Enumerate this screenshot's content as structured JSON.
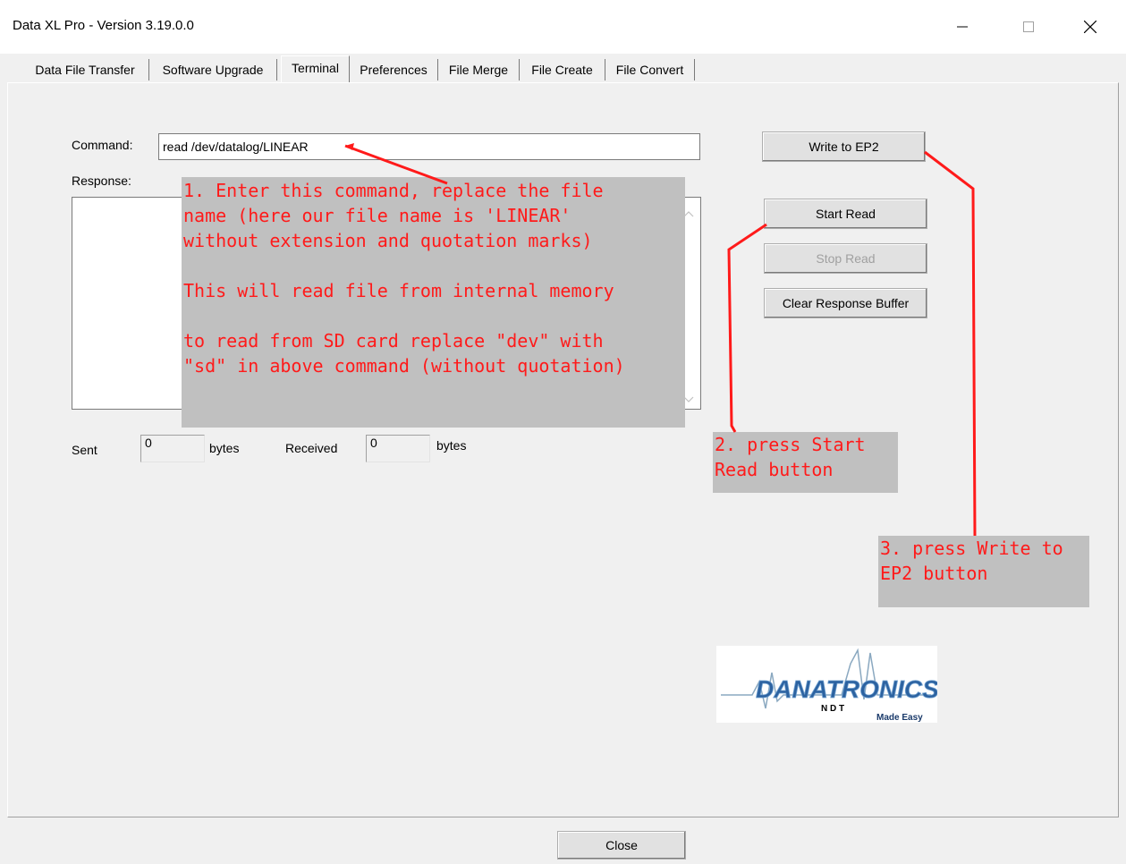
{
  "window": {
    "title": "Data XL Pro - Version 3.19.0.0",
    "controls": [
      "minimize-icon",
      "maximize-icon",
      "close-icon"
    ]
  },
  "tabs": [
    {
      "label": "Data File Transfer",
      "active": false
    },
    {
      "label": "Software Upgrade",
      "active": false
    },
    {
      "label": "Terminal",
      "active": true
    },
    {
      "label": "Preferences",
      "active": false
    },
    {
      "label": "File Merge",
      "active": false
    },
    {
      "label": "File Create",
      "active": false
    },
    {
      "label": "File Convert",
      "active": false
    }
  ],
  "terminal": {
    "command_label": "Command:",
    "command_value": "read /dev/datalog/LINEAR",
    "response_label": "Response:",
    "response_value": "",
    "sent_label": "Sent",
    "sent_value": "0",
    "sent_unit": "bytes",
    "received_label": "Received",
    "received_value": "0",
    "received_unit": "bytes"
  },
  "buttons": {
    "write_ep2": "Write to EP2",
    "start_read": "Start Read",
    "stop_read": "Stop Read",
    "clear_buffer": "Clear Response Buffer",
    "close": "Close"
  },
  "annotations": {
    "note1": "1. Enter this command, replace the file\nname (here our file name is 'LINEAR'\nwithout extension and quotation marks)\n\nThis will read file from internal memory\n\nto read from SD card replace \"dev\" with\n\"sd\" in above command (without quotation)",
    "note2": "2. press Start\nRead button",
    "note3": "3. press Write to\nEP2 button",
    "color": "#ff1a1a",
    "box_color": "#c0c0c0"
  },
  "logo": {
    "brand": "DANATRONICS",
    "sub": "N D T",
    "tagline": "Made Easy"
  }
}
